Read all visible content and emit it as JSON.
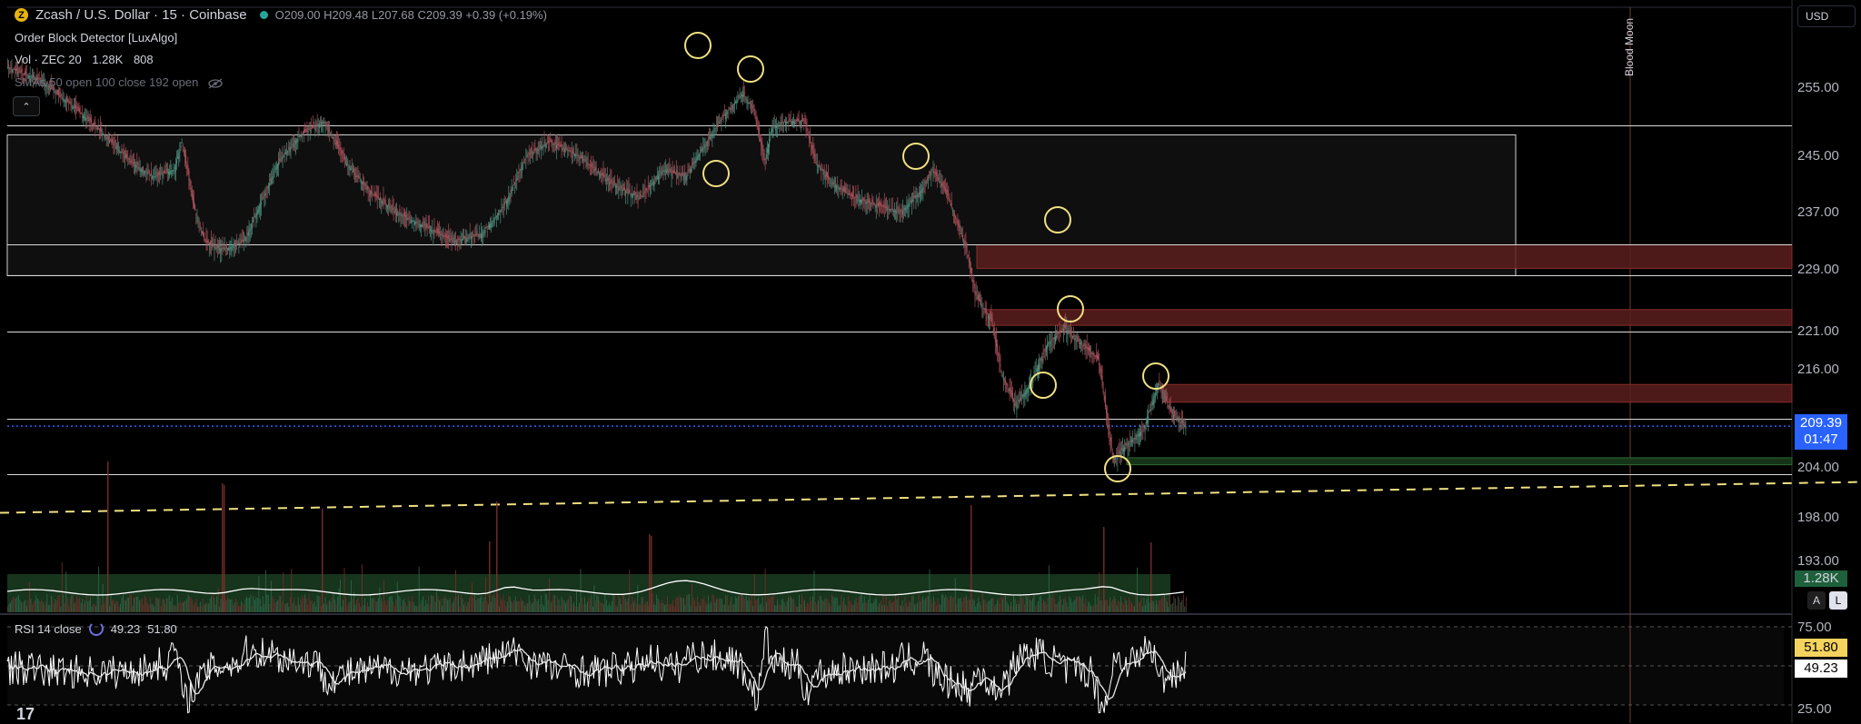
{
  "header": {
    "coin_glyph": "Z",
    "title": "Zcash / U.S. Dollar · 15 · Coinbase",
    "o_label": "O",
    "o": "209.00",
    "h_label": "H",
    "h": "209.48",
    "l_label": "L",
    "l": "207.68",
    "c_label": "C",
    "c": "209.39",
    "change": "+0.39 (+0.19%)"
  },
  "indicators": {
    "ob": "Order Block Detector [LuxAlgo]",
    "vol_label": "Vol · ZEC 20",
    "vol_v1": "1.28K",
    "vol_v2": "808",
    "sma": "SMAs 50 open 100 close 192 open"
  },
  "collapse_glyph": "⌃",
  "currency": "USD",
  "price_axis": [
    "255.00",
    "245.00",
    "237.00",
    "229.00",
    "221.00",
    "216.00",
    "204.00",
    "198.00",
    "193.00"
  ],
  "price_badge": {
    "price": "209.39",
    "countdown": "01:47",
    "color": "#2962ff"
  },
  "volume_badge": {
    "value": "1.28K",
    "color": "#1e5f3c"
  },
  "al_buttons": {
    "a": "A",
    "l": "L"
  },
  "event_label": "Blood Moon",
  "rsi": {
    "label": "RSI 14 close",
    "value": "49.23",
    "ma": "51.80",
    "axis_top": "75.00",
    "axis_bottom": "25.00"
  },
  "logo": "17",
  "colors": {
    "bull": "#26a69a",
    "bear": "#ef5350",
    "bear_ob": "#5a1d1d",
    "bull_ob": "#173a1a",
    "marker": "#f0e080",
    "trend": "#f0e080"
  },
  "chart_data": {
    "type": "candlestick",
    "symbol": "ZECUSD",
    "timeframe": "15",
    "ylim": [
      190,
      262
    ],
    "close_path": [
      [
        0,
        258
      ],
      [
        30,
        256
      ],
      [
        60,
        252
      ],
      [
        80,
        249
      ],
      [
        110,
        244
      ],
      [
        130,
        242
      ],
      [
        148,
        243
      ],
      [
        155,
        247
      ],
      [
        165,
        238
      ],
      [
        175,
        233
      ],
      [
        185,
        232
      ],
      [
        195,
        232
      ],
      [
        210,
        233
      ],
      [
        240,
        244
      ],
      [
        260,
        248
      ],
      [
        280,
        250
      ],
      [
        300,
        244
      ],
      [
        320,
        240
      ],
      [
        345,
        237
      ],
      [
        370,
        235
      ],
      [
        395,
        233
      ],
      [
        420,
        234
      ],
      [
        440,
        238
      ],
      [
        460,
        245
      ],
      [
        480,
        247
      ],
      [
        505,
        245
      ],
      [
        535,
        241
      ],
      [
        560,
        239
      ],
      [
        580,
        243
      ],
      [
        600,
        242
      ],
      [
        630,
        250
      ],
      [
        650,
        254
      ],
      [
        660,
        252
      ],
      [
        670,
        244
      ],
      [
        676,
        249
      ],
      [
        690,
        250
      ],
      [
        705,
        250
      ],
      [
        715,
        244
      ],
      [
        730,
        241
      ],
      [
        750,
        239
      ],
      [
        770,
        238
      ],
      [
        790,
        237
      ],
      [
        808,
        240
      ],
      [
        818,
        243
      ],
      [
        830,
        240
      ],
      [
        848,
        232
      ],
      [
        856,
        226
      ],
      [
        870,
        223
      ],
      [
        880,
        216
      ],
      [
        892,
        212
      ],
      [
        905,
        215
      ],
      [
        920,
        220
      ],
      [
        935,
        222
      ],
      [
        950,
        220
      ],
      [
        965,
        218
      ],
      [
        978,
        205
      ],
      [
        990,
        207
      ],
      [
        1005,
        209
      ],
      [
        1018,
        215
      ],
      [
        1030,
        211
      ],
      [
        1042,
        209.4
      ]
    ],
    "order_blocks": [
      {
        "kind": "bearish",
        "top": 232.5,
        "bottom": 229.2,
        "x_start": 1075
      },
      {
        "kind": "bearish",
        "top": 224.2,
        "bottom": 222.3,
        "x_start": 1085
      },
      {
        "kind": "bearish",
        "top": 214.8,
        "bottom": 212.5,
        "x_start": 1280
      },
      {
        "kind": "bullish",
        "top": 205.3,
        "bottom": 204.4,
        "x_start": 1240
      }
    ],
    "range_box": {
      "top": 248.0,
      "bottom": 228.3,
      "x_start": 8,
      "x_end": 1668
    },
    "horizontal_levels": [
      249.4,
      232.6,
      228.3,
      221.6,
      210.3,
      203.2
    ],
    "trendline": {
      "x1": 0,
      "y1": 198.6,
      "x2": 2048,
      "y2": 202.3
    },
    "markers": [
      [
        768,
        50
      ],
      [
        826,
        76
      ],
      [
        788,
        191
      ],
      [
        1008,
        172
      ],
      [
        1164,
        242
      ],
      [
        1178,
        340
      ],
      [
        1148,
        424
      ],
      [
        1272,
        414
      ],
      [
        1230,
        516
      ]
    ],
    "volume_tall_bars": [
      [
        118,
        508
      ],
      [
        244,
        532
      ],
      [
        246,
        534
      ],
      [
        354,
        560
      ],
      [
        546,
        552
      ],
      [
        538,
        596
      ],
      [
        714,
        588
      ],
      [
        716,
        590
      ],
      [
        1068,
        556
      ],
      [
        1214,
        580
      ],
      [
        1266,
        597
      ]
    ],
    "current_price": 209.39,
    "rsi_value": 49.23,
    "rsi_ma": 51.8
  }
}
